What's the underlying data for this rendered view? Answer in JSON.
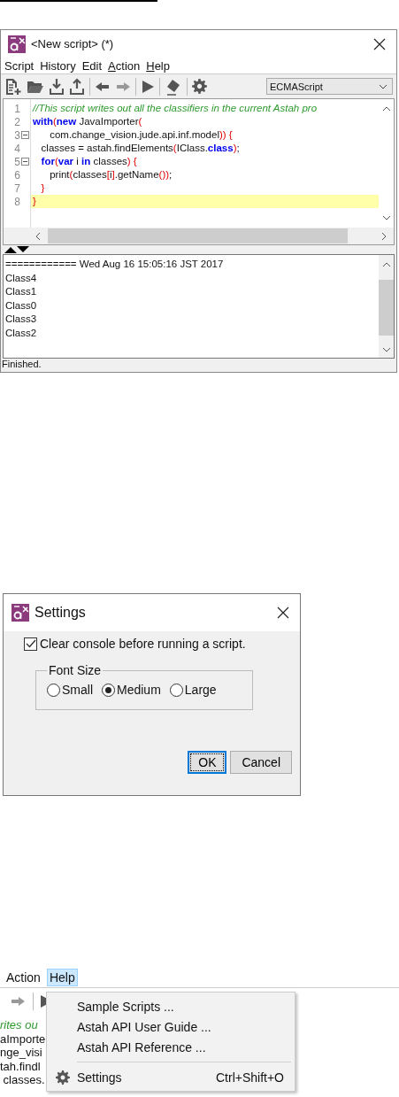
{
  "editor_window": {
    "title": "<New script> (*)",
    "menu": [
      {
        "label": "Script",
        "mnemonic": false
      },
      {
        "label": "History",
        "mnemonic": false
      },
      {
        "label": "Edit",
        "mnemonic": false
      },
      {
        "label": "Action",
        "mnemonic": true
      },
      {
        "label": "Help",
        "mnemonic": true
      }
    ],
    "language": "ECMAScript",
    "code_lines": [
      {
        "number": "1",
        "fold": false,
        "highlighted": false,
        "tokens": [
          {
            "kind": "comment",
            "text": "//This script writes out all the classifiers in the current Astah pro"
          }
        ]
      },
      {
        "number": "2",
        "fold": false,
        "highlighted": false,
        "tokens": [
          {
            "kind": "keyword",
            "text": "with"
          },
          {
            "kind": "bracket",
            "text": "("
          },
          {
            "kind": "keyword",
            "text": "new"
          },
          {
            "kind": "plain",
            "text": " JavaImporter"
          },
          {
            "kind": "bracket",
            "text": "("
          }
        ]
      },
      {
        "number": "3",
        "fold": true,
        "highlighted": false,
        "tokens": [
          {
            "kind": "plain",
            "text": "      com.change_vision.jude.api.inf.model"
          },
          {
            "kind": "bracket",
            "text": "))"
          },
          {
            "kind": "bracket",
            "text": " {"
          }
        ]
      },
      {
        "number": "4",
        "fold": false,
        "highlighted": false,
        "tokens": [
          {
            "kind": "plain",
            "text": "   classes = astah.findElements"
          },
          {
            "kind": "bracket",
            "text": "("
          },
          {
            "kind": "plain",
            "text": "IClass."
          },
          {
            "kind": "keyword",
            "text": "class"
          },
          {
            "kind": "bracket",
            "text": ")"
          },
          {
            "kind": "plain",
            "text": ";"
          }
        ]
      },
      {
        "number": "5",
        "fold": true,
        "highlighted": false,
        "tokens": [
          {
            "kind": "keyword",
            "text": "   for"
          },
          {
            "kind": "bracket",
            "text": "("
          },
          {
            "kind": "keyword",
            "text": "var"
          },
          {
            "kind": "plain",
            "text": " i "
          },
          {
            "kind": "keyword",
            "text": "in"
          },
          {
            "kind": "plain",
            "text": " classes"
          },
          {
            "kind": "bracket",
            "text": ")"
          },
          {
            "kind": "bracket",
            "text": " {"
          }
        ]
      },
      {
        "number": "6",
        "fold": false,
        "highlighted": false,
        "tokens": [
          {
            "kind": "plain",
            "text": "      print"
          },
          {
            "kind": "bracket",
            "text": "("
          },
          {
            "kind": "plain",
            "text": "classes"
          },
          {
            "kind": "bracket",
            "text": "["
          },
          {
            "kind": "plain",
            "text": "i"
          },
          {
            "kind": "bracket",
            "text": "]"
          },
          {
            "kind": "plain",
            "text": ".getName"
          },
          {
            "kind": "bracket",
            "text": "())"
          },
          {
            "kind": "plain",
            "text": ";"
          }
        ]
      },
      {
        "number": "7",
        "fold": false,
        "highlighted": false,
        "tokens": [
          {
            "kind": "bracket",
            "text": "   }"
          }
        ]
      },
      {
        "number": "8",
        "fold": false,
        "highlighted": true,
        "tokens": [
          {
            "kind": "bracket",
            "text": "}"
          }
        ]
      }
    ],
    "console_lines": [
      "============ Wed Aug 16 15:05:16 JST 2017",
      "Class4",
      "Class1",
      "Class0",
      "Class3",
      "Class2"
    ],
    "status": "Finished."
  },
  "settings_dialog": {
    "title": "Settings",
    "clear_console": {
      "label": "Clear console before running a script.",
      "checked": true
    },
    "font_size": {
      "legend": "Font Size",
      "options": [
        {
          "label": "Small",
          "selected": false
        },
        {
          "label": "Medium",
          "selected": true
        },
        {
          "label": "Large",
          "selected": false
        }
      ]
    },
    "buttons": [
      {
        "label": "OK",
        "focused": true
      },
      {
        "label": "Cancel",
        "focused": false
      }
    ]
  },
  "help_menu_view": {
    "menu_bar": [
      {
        "label": "Action",
        "selected": false
      },
      {
        "label": "Help",
        "selected": true
      }
    ],
    "behind_code": [
      {
        "kind": "comment",
        "text": "rites ou"
      },
      {
        "kind": "plain",
        "text": "aImporte"
      },
      {
        "kind": "plain",
        "text": "nge_visi"
      },
      {
        "kind": "plain",
        "text": "tah.findl"
      },
      {
        "kind": "plain",
        "text": " classes."
      }
    ],
    "items": [
      {
        "kind": "item",
        "label": "Sample Scripts ..."
      },
      {
        "kind": "item",
        "label": "Astah API User Guide ..."
      },
      {
        "kind": "item",
        "label": "Astah API Reference ..."
      },
      {
        "kind": "separator"
      },
      {
        "kind": "gear",
        "label": "Settings",
        "shortcut": "Ctrl+Shift+O"
      }
    ]
  }
}
